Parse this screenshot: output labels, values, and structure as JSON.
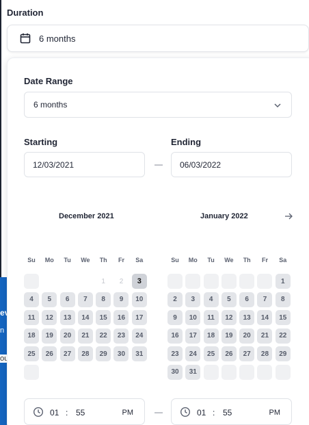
{
  "duration": {
    "label": "Duration",
    "value": "6 months"
  },
  "date_range": {
    "label": "Date Range",
    "value": "6 months"
  },
  "starting": {
    "label": "Starting",
    "value": "12/03/2021"
  },
  "ending": {
    "label": "Ending",
    "value": "06/03/2022"
  },
  "separator": "—",
  "calendar": {
    "weekdays": [
      "Su",
      "Mo",
      "Tu",
      "We",
      "Th",
      "Fr",
      "Sa"
    ],
    "left": {
      "title": "December 2021",
      "days": [
        {
          "d": "",
          "s": "empty"
        },
        {
          "d": "",
          "s": "blank"
        },
        {
          "d": "",
          "s": "blank"
        },
        {
          "d": "",
          "s": "blank"
        },
        {
          "d": "1",
          "s": "muted"
        },
        {
          "d": "2",
          "s": "muted"
        },
        {
          "d": "3",
          "s": "selected"
        },
        {
          "d": "4",
          "s": ""
        },
        {
          "d": "5",
          "s": ""
        },
        {
          "d": "6",
          "s": ""
        },
        {
          "d": "7",
          "s": ""
        },
        {
          "d": "8",
          "s": ""
        },
        {
          "d": "9",
          "s": ""
        },
        {
          "d": "10",
          "s": ""
        },
        {
          "d": "11",
          "s": ""
        },
        {
          "d": "12",
          "s": ""
        },
        {
          "d": "13",
          "s": ""
        },
        {
          "d": "14",
          "s": ""
        },
        {
          "d": "15",
          "s": ""
        },
        {
          "d": "16",
          "s": ""
        },
        {
          "d": "17",
          "s": ""
        },
        {
          "d": "18",
          "s": ""
        },
        {
          "d": "19",
          "s": ""
        },
        {
          "d": "20",
          "s": ""
        },
        {
          "d": "21",
          "s": ""
        },
        {
          "d": "22",
          "s": ""
        },
        {
          "d": "23",
          "s": ""
        },
        {
          "d": "24",
          "s": ""
        },
        {
          "d": "25",
          "s": ""
        },
        {
          "d": "26",
          "s": ""
        },
        {
          "d": "27",
          "s": ""
        },
        {
          "d": "28",
          "s": ""
        },
        {
          "d": "29",
          "s": ""
        },
        {
          "d": "30",
          "s": ""
        },
        {
          "d": "31",
          "s": ""
        },
        {
          "d": "",
          "s": "empty"
        }
      ]
    },
    "right": {
      "title": "January 2022",
      "days": [
        {
          "d": "",
          "s": "empty"
        },
        {
          "d": "",
          "s": "empty"
        },
        {
          "d": "",
          "s": "empty"
        },
        {
          "d": "",
          "s": "empty"
        },
        {
          "d": "",
          "s": "empty"
        },
        {
          "d": "",
          "s": "empty"
        },
        {
          "d": "1",
          "s": ""
        },
        {
          "d": "2",
          "s": ""
        },
        {
          "d": "3",
          "s": ""
        },
        {
          "d": "4",
          "s": ""
        },
        {
          "d": "5",
          "s": ""
        },
        {
          "d": "6",
          "s": ""
        },
        {
          "d": "7",
          "s": ""
        },
        {
          "d": "8",
          "s": ""
        },
        {
          "d": "9",
          "s": ""
        },
        {
          "d": "10",
          "s": ""
        },
        {
          "d": "11",
          "s": ""
        },
        {
          "d": "12",
          "s": ""
        },
        {
          "d": "13",
          "s": ""
        },
        {
          "d": "14",
          "s": ""
        },
        {
          "d": "15",
          "s": ""
        },
        {
          "d": "16",
          "s": ""
        },
        {
          "d": "17",
          "s": ""
        },
        {
          "d": "18",
          "s": ""
        },
        {
          "d": "19",
          "s": ""
        },
        {
          "d": "20",
          "s": ""
        },
        {
          "d": "21",
          "s": ""
        },
        {
          "d": "22",
          "s": ""
        },
        {
          "d": "23",
          "s": ""
        },
        {
          "d": "24",
          "s": ""
        },
        {
          "d": "25",
          "s": ""
        },
        {
          "d": "26",
          "s": ""
        },
        {
          "d": "27",
          "s": ""
        },
        {
          "d": "28",
          "s": ""
        },
        {
          "d": "29",
          "s": ""
        },
        {
          "d": "30",
          "s": ""
        },
        {
          "d": "31",
          "s": ""
        },
        {
          "d": "",
          "s": "empty"
        },
        {
          "d": "",
          "s": "empty"
        },
        {
          "d": "",
          "s": "empty"
        },
        {
          "d": "",
          "s": "empty"
        },
        {
          "d": "",
          "s": "empty"
        }
      ]
    },
    "next_icon": "arrow-right-icon"
  },
  "start_time": {
    "hours": "01",
    "colon": ":",
    "minutes": "55",
    "period": "PM"
  },
  "end_time": {
    "hours": "01",
    "colon": ":",
    "minutes": "55",
    "period": "PM"
  },
  "background_partial_text": [
    "ev",
    "n",
    "ou"
  ],
  "colors": {
    "accent_strip": "#1565c0",
    "day_bg": "#e3e5e9",
    "selected_day_bg": "#cfd2d8"
  }
}
